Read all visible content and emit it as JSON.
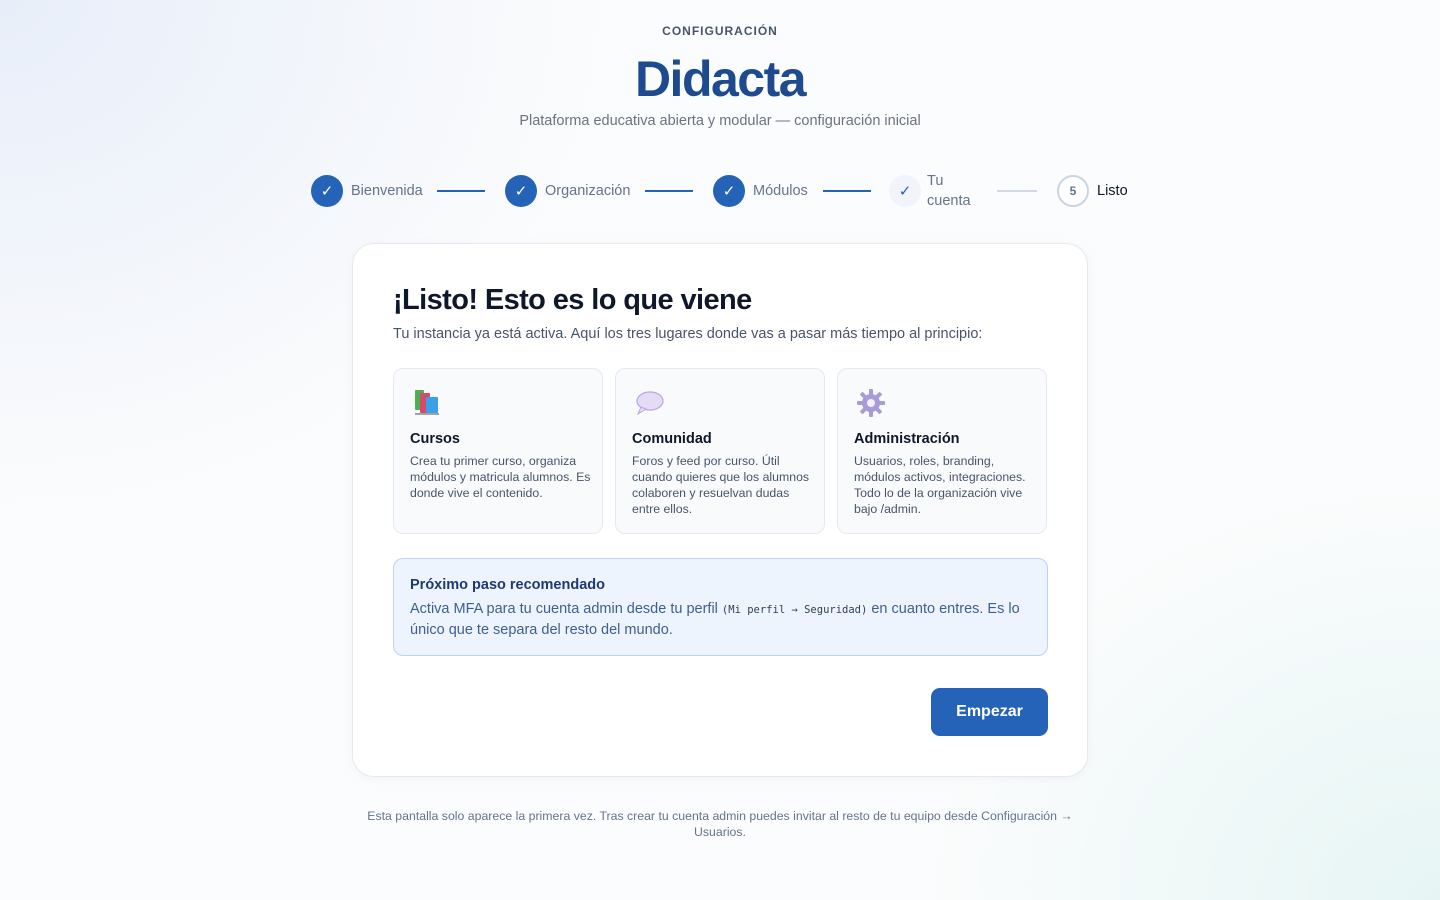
{
  "header": {
    "eyebrow": "CONFIGURACIÓN",
    "brand": "Didacta",
    "tagline": "Plataforma educativa abierta y modular — configuración inicial"
  },
  "stepper": {
    "steps": [
      {
        "label": "Bienvenida",
        "state": "done",
        "marker": "✓"
      },
      {
        "label": "Organización",
        "state": "done",
        "marker": "✓"
      },
      {
        "label": "Módulos",
        "state": "done",
        "marker": "✓"
      },
      {
        "label_line1": "Tu",
        "label_line2": "cuenta",
        "state": "done-light",
        "marker": "✓"
      },
      {
        "label": "Listo",
        "state": "current",
        "marker": "5"
      }
    ]
  },
  "card": {
    "title": "¡Listo! Esto es lo que viene",
    "subtitle": "Tu instancia ya está activa. Aquí los tres lugares donde vas a pasar más tiempo al principio:",
    "tiles": [
      {
        "icon": "books-icon",
        "title": "Cursos",
        "description": "Crea tu primer curso, organiza módulos y matricula alumnos. Es donde vive el contenido."
      },
      {
        "icon": "speech-bubble-icon",
        "title": "Comunidad",
        "description": "Foros y feed por curso. Útil cuando quieres que los alumnos colaboren y resuelvan dudas entre ellos."
      },
      {
        "icon": "gear-icon",
        "title": "Administración",
        "description": "Usuarios, roles, branding, módulos activos, integraciones. Todo lo de la organización vive bajo /admin."
      }
    ],
    "callout": {
      "title": "Próximo paso recomendado",
      "text_before": "Activa MFA para tu cuenta admin desde tu perfil ",
      "code": "(Mi perfil → Seguridad)",
      "text_after": " en cuanto entres. Es lo único que te separa del resto del mundo."
    },
    "start_button": "Empezar"
  },
  "footer": {
    "note": "Esta pantalla solo aparece la primera vez. Tras crear tu cuenta admin puedes invitar al resto de tu equipo desde Configuración → Usuarios."
  },
  "colors": {
    "accent": "#2563b8",
    "brand": "#1e4b8f",
    "callout_bg": "#edf4fe"
  }
}
